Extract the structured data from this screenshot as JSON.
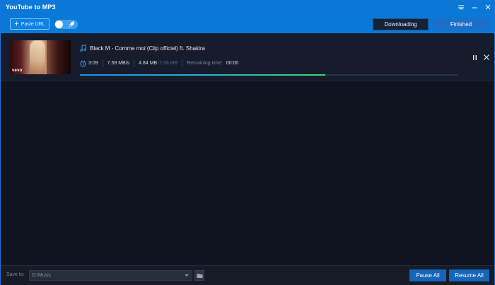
{
  "app": {
    "title": "YouTube to MP3"
  },
  "toolbar": {
    "paste_url_label": "Paste URL",
    "turbo_toggle_on": false,
    "tabs": [
      {
        "label": "Downloading",
        "active": true
      },
      {
        "label": "Finished",
        "active": false
      }
    ]
  },
  "downloads": [
    {
      "title": "Black M - Comme moi (Clip officiel) ft. Shakira",
      "thumbnail_badge": "vevo",
      "duration": "3:09",
      "speed": "7.59 MB/s",
      "downloaded": "4.84 MB",
      "total": "/7.58 MB",
      "remaining_label": "Remaining time:",
      "remaining_time": "00:00",
      "progress": 0.65
    }
  ],
  "footer": {
    "save_to_label": "Save to:",
    "save_path": "D:\\Music",
    "pause_all_label": "Pause All",
    "resume_all_label": "Resume All"
  },
  "colors": {
    "accent": "#0a78d7",
    "background": "#0f1420",
    "button": "#1565b8",
    "progress_start": "#1f8fe8",
    "progress_end": "#39d86e"
  }
}
